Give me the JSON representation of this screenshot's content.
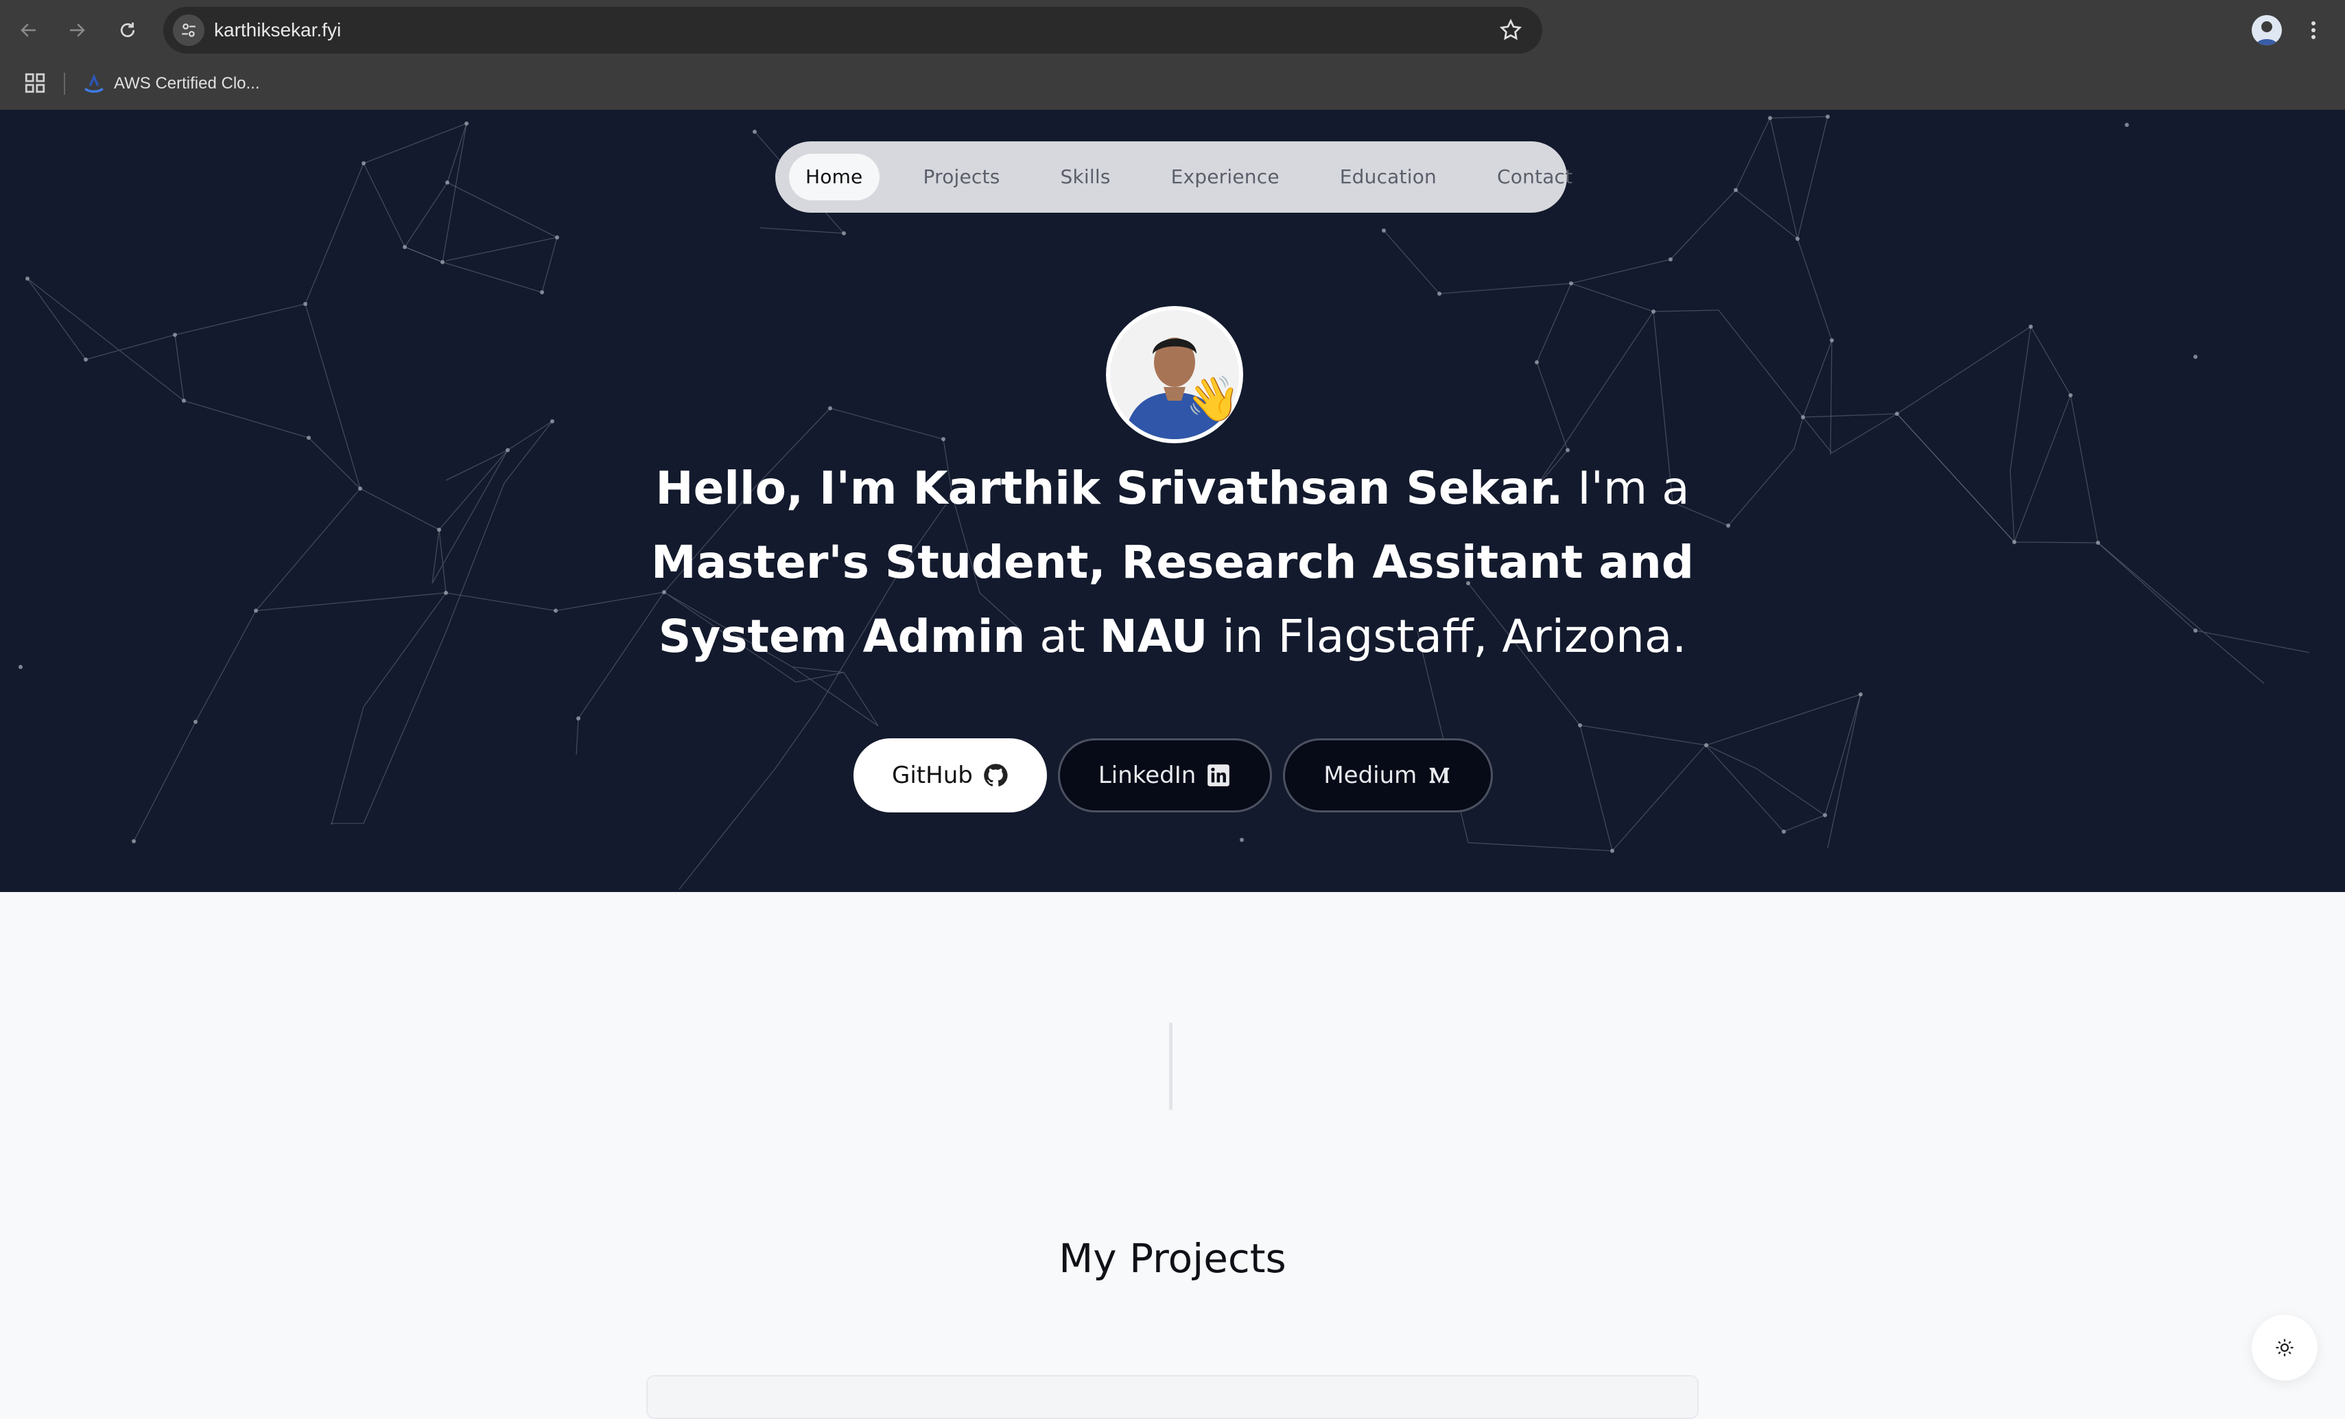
{
  "browser": {
    "url": "karthiksekar.fyi",
    "bookmarks": [
      {
        "label": "AWS Certified Clo..."
      }
    ],
    "icons": {
      "back": "arrow-left-icon",
      "forward": "arrow-right-icon",
      "reload": "reload-icon",
      "site_info": "tune-icon",
      "bookmark_star": "star-icon",
      "apps": "apps-grid-icon",
      "menu": "kebab-menu-icon"
    }
  },
  "nav": {
    "items": [
      {
        "label": "Home",
        "active": true
      },
      {
        "label": "Projects",
        "active": false
      },
      {
        "label": "Skills",
        "active": false
      },
      {
        "label": "Experience",
        "active": false
      },
      {
        "label": "Education",
        "active": false
      },
      {
        "label": "Contact",
        "active": false
      }
    ]
  },
  "hero": {
    "wave_emoji": "👋",
    "headline": {
      "line1_bold": "Hello, I'm Karthik Srivathsan Sekar.",
      "line1_rest": " I'm a",
      "line2_bold": "Master's Student, Research Assitant and",
      "line3_bold1": "System Admin",
      "line3_mid": " at ",
      "line3_bold2": "NAU",
      "line3_rest": " in Flagstaff, Arizona."
    },
    "buttons": [
      {
        "label": "GitHub",
        "icon": "github-icon"
      },
      {
        "label": "LinkedIn",
        "icon": "linkedin-icon"
      },
      {
        "label": "Medium",
        "icon": "medium-icon"
      }
    ],
    "colors": {
      "background": "#131a2d",
      "nav_pill": "#d6d8dd"
    }
  },
  "main": {
    "section_title": "My Projects",
    "theme_toggle_icon": "sun-icon"
  }
}
